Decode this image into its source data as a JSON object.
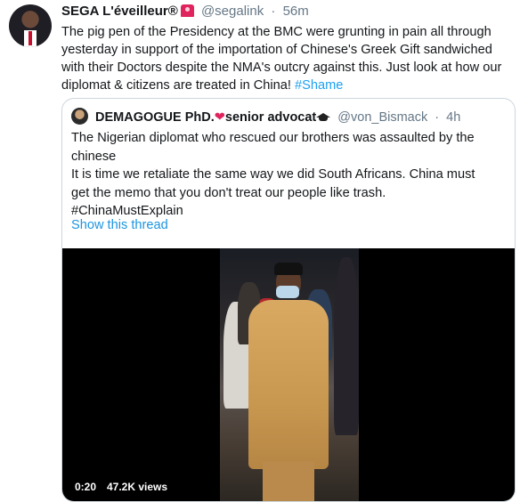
{
  "tweet": {
    "author_name": "SEGA L'éveilleur®",
    "author_handle": "@segalink",
    "separator": "·",
    "time": "56m",
    "text": "The pig pen of the Presidency at the BMC were grunting in pain all through yesterday in support of the importation of Chinese's Greek Gift sandwiched with their Doctors despite the NMA's outcry against this. Just look at how our diplomat & citizens are treated in China! ",
    "hashtag": "#Shame",
    "avatar_icon": "profile-photo",
    "badge_icon": "rotating-light-emoji"
  },
  "quoted": {
    "author_name": "DEMAGOGUE PhD.",
    "author_suffix": "senior advocat",
    "author_handle": "@von_Bismack",
    "separator": "·",
    "time": "4h",
    "lines": [
      "The Nigerian diplomat who rescued our brothers was assaulted by the",
      "chinese",
      "It is time we retaliate the same way we did South Africans. China must",
      "get the memo that you don't treat our people like trash.",
      "#ChinaMustExplain"
    ],
    "show_thread": "Show this thread",
    "heart_icon": "broken-heart-emoji",
    "cap_icon": "graduation-cap-emoji"
  },
  "video": {
    "time": "0:20",
    "views": "47.2K views"
  },
  "colors": {
    "link": "#1da1f2",
    "text": "#14171a",
    "muted": "#657786",
    "border": "#ccd6dd"
  }
}
